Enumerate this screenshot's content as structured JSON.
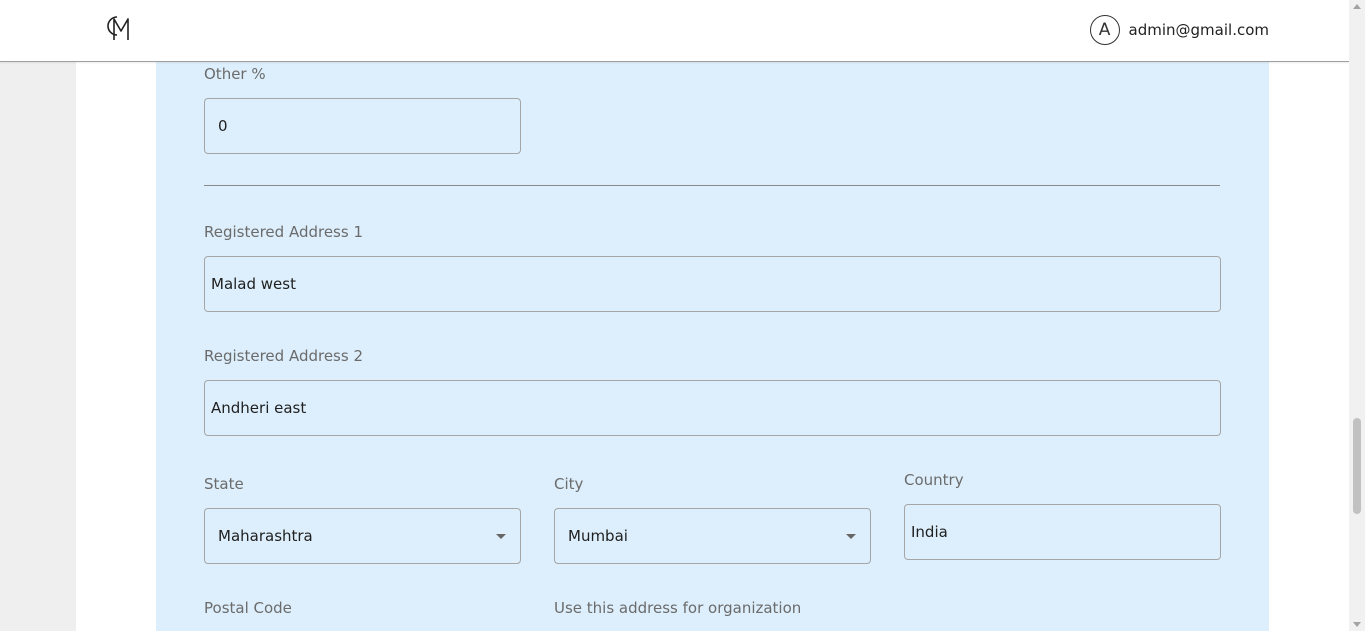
{
  "header": {
    "logo_icon": "cm-monogram-logo",
    "avatar_letter": "A",
    "user_email": "admin@gmail.com"
  },
  "form": {
    "other_percent": {
      "label": "Other %",
      "value": "0"
    },
    "address1": {
      "label": "Registered Address 1",
      "value": "Malad west"
    },
    "address2": {
      "label": "Registered Address 2",
      "value": "Andheri east"
    },
    "state": {
      "label": "State",
      "value": "Maharashtra"
    },
    "city": {
      "label": "City",
      "value": "Mumbai"
    },
    "country": {
      "label": "Country",
      "value": "India"
    },
    "postal_code": {
      "label": "Postal Code"
    },
    "use_address": {
      "label": "Use this address for organization"
    }
  },
  "colors": {
    "card_background": "#ddeffc",
    "page_background": "#efefef",
    "border": "#a5a5a5"
  }
}
